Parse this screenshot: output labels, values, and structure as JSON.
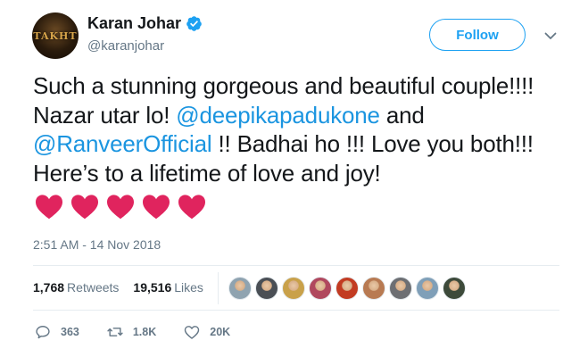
{
  "author": {
    "display_name": "Karan Johar",
    "handle": "@karanjohar",
    "avatar_label": "TAKHT"
  },
  "follow_button": {
    "label": "Follow"
  },
  "tweet": {
    "part1": "Such a stunning gorgeous and beautiful couple!!!! Nazar utar lo! ",
    "mention1": "@deepikapadukone",
    "part2": " and ",
    "mention2": "@RanveerOfficial",
    "part3": " !! Badhai ho !!! Love you both!!! Here’s to a lifetime of love and joy!",
    "emoji": [
      "red-heart",
      "red-heart",
      "red-heart",
      "red-heart",
      "red-heart"
    ]
  },
  "timestamp": "2:51 AM - 14 Nov 2018",
  "stats": {
    "retweets_count": "1,768",
    "retweets_label": "Retweets",
    "likes_count": "19,516",
    "likes_label": "Likes"
  },
  "liker_avatars": [
    "#8fa3b0",
    "#4a4f55",
    "#c9a14a",
    "#b0485e",
    "#c23b22",
    "#b87a52",
    "#6d6f73",
    "#7f9fb8",
    "#3d4a3a"
  ],
  "actions": {
    "reply_count": "363",
    "retweet_count": "1.8K",
    "like_count": "20K"
  },
  "colors": {
    "brand_blue": "#1da1f2",
    "mention_blue": "#1b95e0",
    "heart_red": "#e0245e",
    "secondary_text": "#657786"
  }
}
